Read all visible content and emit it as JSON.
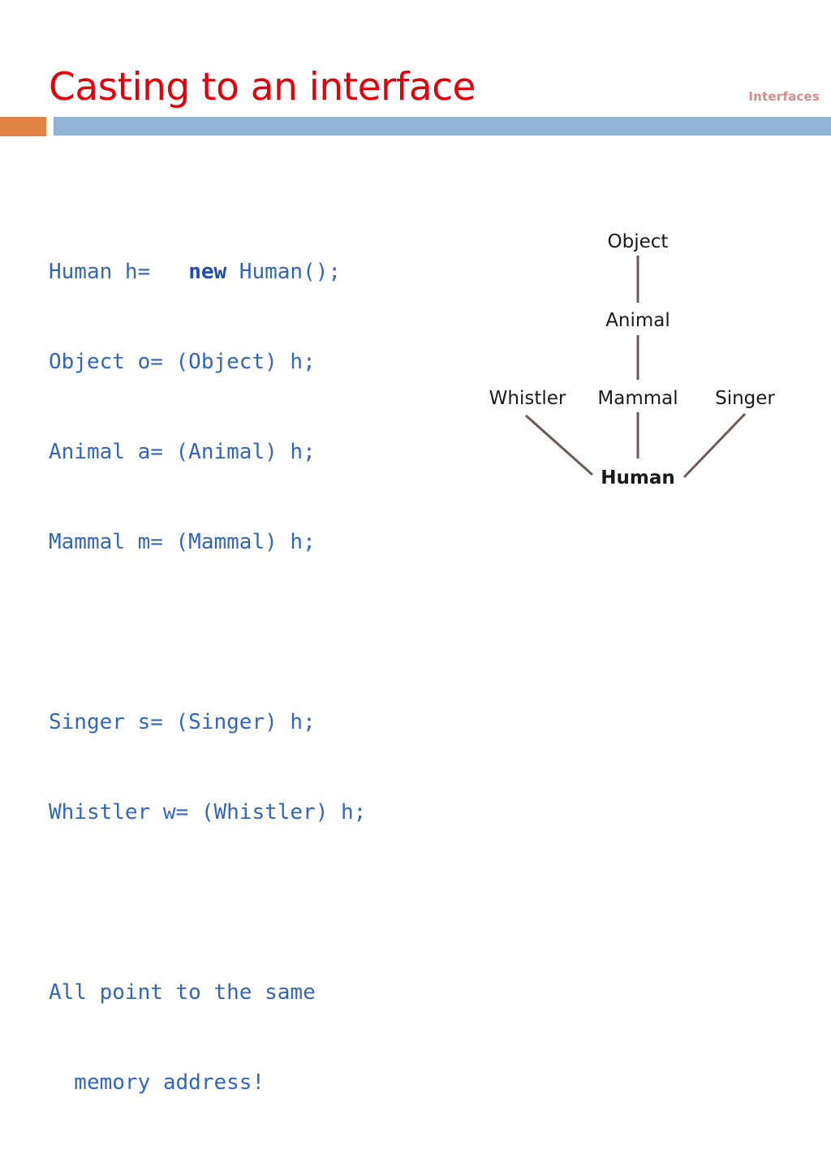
{
  "header": {
    "title": "Casting to an interface",
    "tag": "Interfaces",
    "title_color": "#e3000b",
    "tag_color": "#d98b8b",
    "accent_square_color": "#df8244",
    "accent_bar_color": "#91b3d5"
  },
  "code": {
    "text_color": "#3366bb",
    "keyword_color": "#1f4fae",
    "lines": [
      {
        "id": "line-1",
        "pre": "Human h=   ",
        "keyword": "new",
        "post": " Human();"
      },
      {
        "id": "line-2",
        "pre": "Object o= (Object) h;",
        "keyword": "",
        "post": ""
      },
      {
        "id": "line-3",
        "pre": "Animal a= (Animal) h;",
        "keyword": "",
        "post": ""
      },
      {
        "id": "line-4",
        "pre": "Mammal m= (Mammal) h;",
        "keyword": "",
        "post": ""
      },
      {
        "id": "line-5",
        "pre": "",
        "keyword": "",
        "post": ""
      },
      {
        "id": "line-6",
        "pre": "Singer s= (Singer) h;",
        "keyword": "",
        "post": ""
      },
      {
        "id": "line-7",
        "pre": "Whistler w= (Whistler) h;",
        "keyword": "",
        "post": ""
      },
      {
        "id": "line-8",
        "pre": "",
        "keyword": "",
        "post": ""
      },
      {
        "id": "line-9",
        "pre": "All point to the same",
        "keyword": "",
        "post": ""
      },
      {
        "id": "line-10",
        "pre": "  memory address!",
        "keyword": "",
        "post": ""
      }
    ],
    "line_1_pre": "Human h=   ",
    "line_1_keyword": "new",
    "line_1_post": " Human();",
    "line_2": "Object o= (Object) h;",
    "line_3": "Animal a= (Animal) h;",
    "line_4": "Mammal m= (Mammal) h;",
    "line_6": "Singer s= (Singer) h;",
    "line_7": "Whistler w= (Whistler) h;",
    "line_9": "All point to the same",
    "line_10": "  memory address!"
  },
  "diagram": {
    "line_color": "#6b5b53",
    "nodes": {
      "object": "Object",
      "animal": "Animal",
      "mammal": "Mammal",
      "whistler": "Whistler",
      "singer": "Singer",
      "human": "Human"
    }
  }
}
